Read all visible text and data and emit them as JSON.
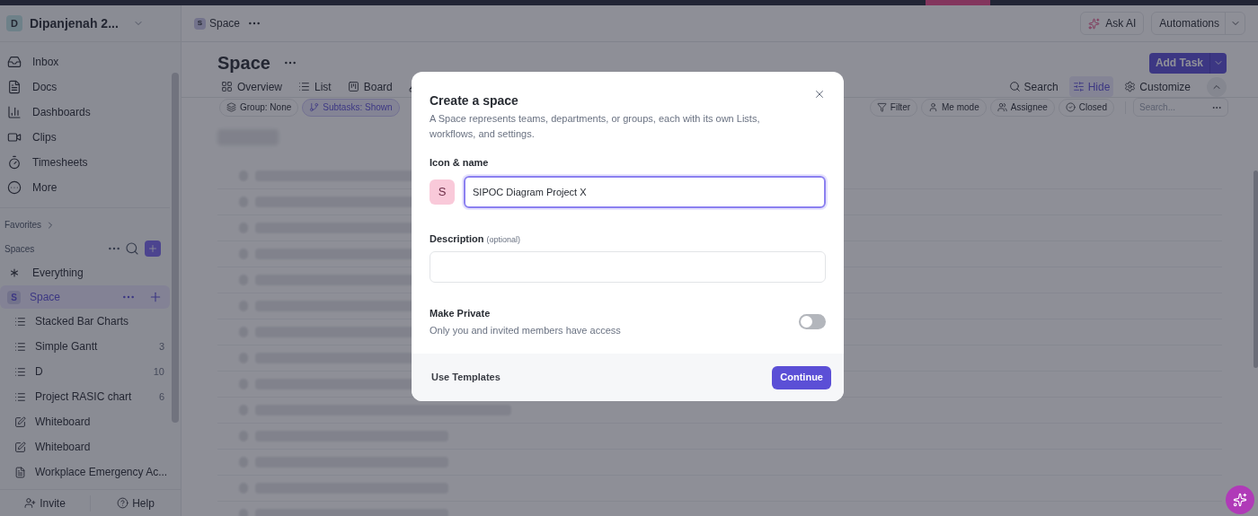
{
  "workspace": {
    "initial": "D",
    "name": "Dipanjenah 2..."
  },
  "nav": [
    "Inbox",
    "Docs",
    "Dashboards",
    "Clips",
    "Timesheets",
    "More"
  ],
  "favorites": "Favorites",
  "spaces_label": "Spaces",
  "everything": "Everything",
  "space": {
    "initial": "S",
    "name": "Space",
    "selected": true
  },
  "space_items": [
    {
      "kind": "list",
      "name": "Stacked Bar Charts"
    },
    {
      "kind": "list",
      "name": "Simple Gantt",
      "count": "3"
    },
    {
      "kind": "list",
      "name": "D",
      "count": "10"
    },
    {
      "kind": "list",
      "name": "Project RASIC chart",
      "count": "6"
    },
    {
      "kind": "whiteboard",
      "name": "Whiteboard"
    },
    {
      "kind": "whiteboard",
      "name": "Whiteboard"
    },
    {
      "kind": "doc",
      "name": "Workplace Emergency Ac..."
    }
  ],
  "footer": [
    "Invite",
    "Help"
  ],
  "breadcrumb": {
    "initial": "S",
    "name": "Space"
  },
  "top_buttons": [
    "Ask AI",
    "Automations"
  ],
  "title": "Space",
  "add_task": "Add Task",
  "views": [
    "Overview",
    "List",
    "Board"
  ],
  "view_tools": [
    {
      "label": "Search",
      "active": false
    },
    {
      "label": "Hide",
      "active": true
    },
    {
      "label": "Customize",
      "active": false
    }
  ],
  "chips": [
    {
      "label": "Group: None",
      "active": false
    },
    {
      "label": "Subtasks: Shown",
      "active": true
    }
  ],
  "filters": [
    "Filter",
    "Me mode",
    "Assignee",
    "Closed"
  ],
  "search_placeholder": "Search...",
  "modal": {
    "title": "Create a space",
    "subtitle": "A Space represents teams, departments, or groups, each with its own Lists, workflows, and settings.",
    "name_label": "Icon & name",
    "icon_letter": "S",
    "name_value": "SIPOC Diagram Project X",
    "description_label": "Description",
    "description_hint": "(optional)",
    "private_label": "Make Private",
    "private_hint": "Only you and invited members have access",
    "private_on": false,
    "templates": "Use Templates",
    "continue": "Continue"
  }
}
